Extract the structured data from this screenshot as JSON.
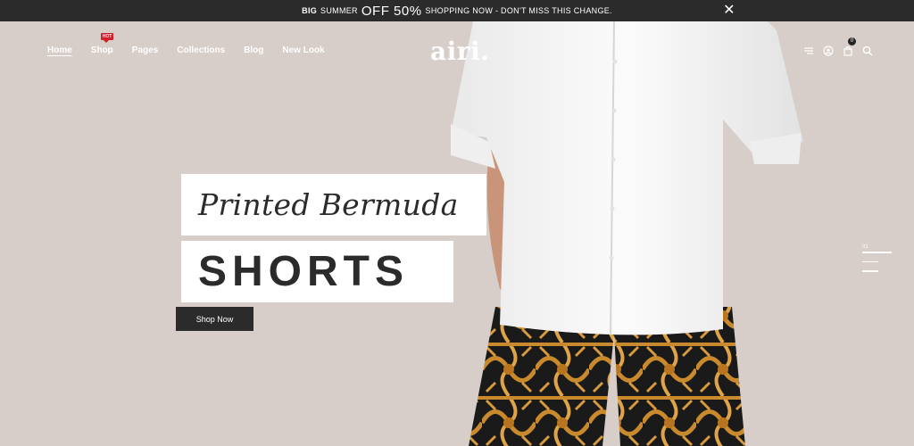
{
  "promo": {
    "strong": "BIG",
    "prefix": "SUMMER",
    "off": "OFF 50%",
    "suffix": "SHOPPING NOW - DON'T MISS THIS CHANGE."
  },
  "nav": {
    "items": [
      {
        "label": "Home"
      },
      {
        "label": "Shop",
        "badge": "HOT"
      },
      {
        "label": "Pages"
      },
      {
        "label": "Collections"
      },
      {
        "label": "Blog"
      },
      {
        "label": "New Look"
      }
    ]
  },
  "logo": "airi.",
  "header_icons": {
    "cart_count": "0"
  },
  "hero": {
    "line1": "Printed Bermuda",
    "line2": "SHORTS",
    "cta": "Shop Now",
    "slide_num": "01"
  },
  "colors": {
    "background": "#d7cdc9",
    "dark": "#2b2b2b",
    "hot_badge": "#d21f2a"
  }
}
